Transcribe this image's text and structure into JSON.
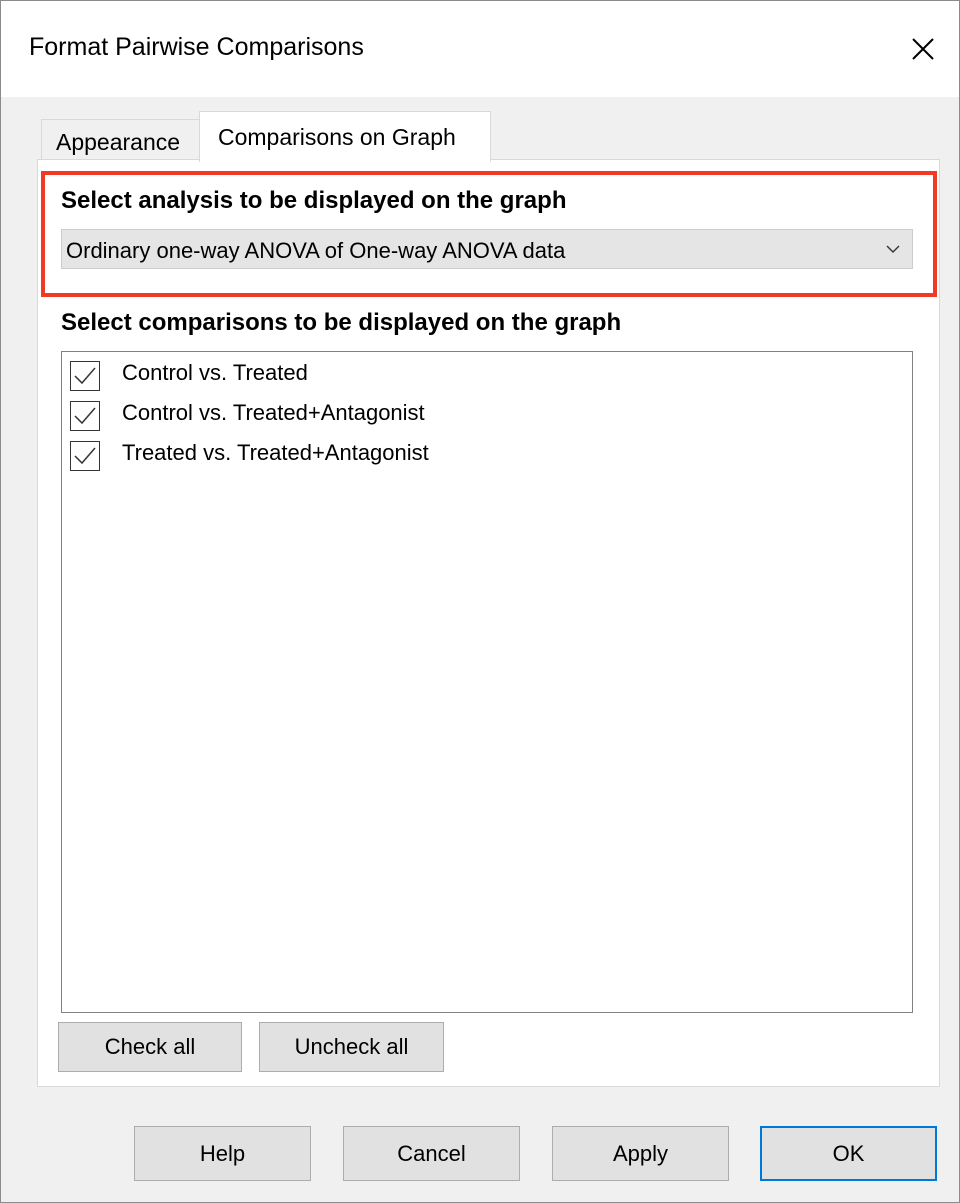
{
  "window": {
    "title": "Format Pairwise Comparisons",
    "close_icon": "close-icon"
  },
  "tabs": [
    {
      "label": "Appearance",
      "active": false
    },
    {
      "label": "Comparisons on Graph",
      "active": true
    }
  ],
  "analysis": {
    "heading": "Select analysis to be displayed on the graph",
    "selected": "Ordinary one-way ANOVA of One-way ANOVA data",
    "highlight_color": "#f03a24"
  },
  "comparisons": {
    "heading": "Select comparisons to be displayed on the graph",
    "items": [
      {
        "label": "Control vs. Treated",
        "checked": true
      },
      {
        "label": "Control vs. Treated+Antagonist",
        "checked": true
      },
      {
        "label": "Treated vs. Treated+Antagonist",
        "checked": true
      }
    ],
    "check_all_label": "Check all",
    "uncheck_all_label": "Uncheck all"
  },
  "footer": {
    "help_label": "Help",
    "cancel_label": "Cancel",
    "apply_label": "Apply",
    "ok_label": "OK",
    "default_button_color": "#0078d7"
  }
}
